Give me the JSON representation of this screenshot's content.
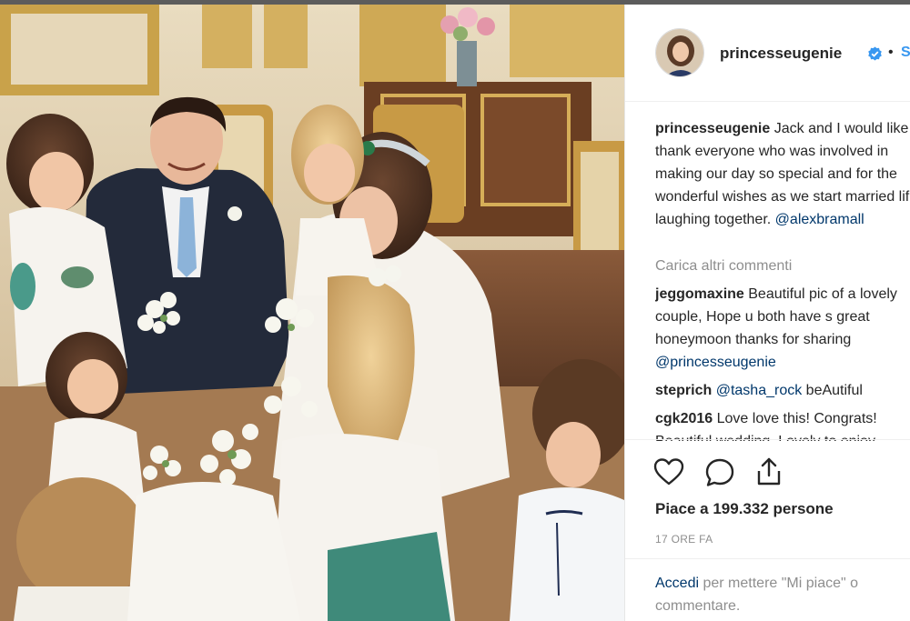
{
  "post": {
    "username": "princesseugenie",
    "follow_label": "Segui",
    "separator": "•"
  },
  "caption": {
    "user": "princesseugenie",
    "lines": [
      " Jack and I would like to",
      "thank everyone who was involved in",
      "making our day so special and for the",
      "wonderful wishes as we start married life",
      "laughing together. "
    ],
    "mention": "@alexbramall"
  },
  "load_more_label": "Carica altri commenti",
  "comments": [
    {
      "user": "jeggomaxine",
      "lines": [
        " Beautiful pic of a lovely",
        "couple, Hope u both have s great",
        "honeymoon thanks for sharing"
      ],
      "mention": "@princesseugenie"
    },
    {
      "user": "steprich",
      "mention": "@tasha_rock",
      "text": " beAutiful"
    },
    {
      "user": "cgk2016",
      "lines": [
        " Love love this! Congrats!",
        "Beautiful wedding. Lovely to enjoy"
      ]
    }
  ],
  "likes": {
    "prefix": "Piace a ",
    "count": "199.332",
    "suffix": " persone"
  },
  "timestamp": "17 ORE FA",
  "login": {
    "link": "Accedi",
    "text": " per mettere \"Mi piace\" o",
    "line2": "commentare."
  },
  "icons": {
    "like": "heart-icon",
    "comment": "comment-bubble-icon",
    "share": "share-icon",
    "verified": "verified-badge-icon"
  },
  "colors": {
    "link": "#3897f0",
    "mention": "#00376b",
    "muted": "#8e8e8e",
    "text": "#262626"
  }
}
